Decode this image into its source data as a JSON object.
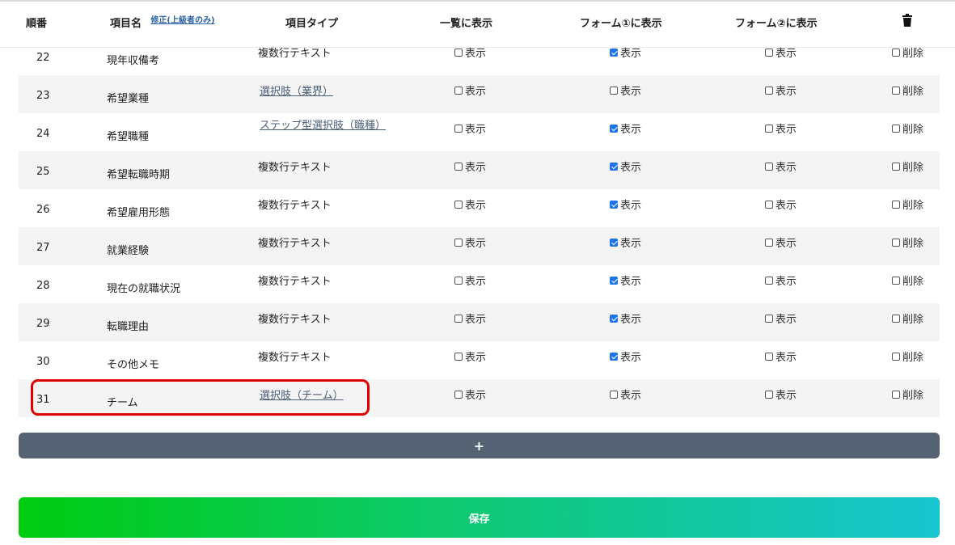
{
  "header": {
    "order": "順番",
    "name": "項目名",
    "name_edit_link": "修正(上級者のみ)",
    "type": "項目タイプ",
    "show_in_list": "一覧に表示",
    "show_in_form1": "フォーム①に表示",
    "show_in_form2": "フォーム②に表示",
    "trash_icon": "trash-icon"
  },
  "labels": {
    "show": "表示",
    "delete": "削除"
  },
  "rows": [
    {
      "order": "22",
      "name": "現年収備考",
      "type": "複数行テキスト",
      "type_is_link": false,
      "list": false,
      "form1": true,
      "form2": false,
      "delete": false
    },
    {
      "order": "23",
      "name": "希望業種",
      "type": "選択肢（業界）",
      "type_is_link": true,
      "list": false,
      "form1": false,
      "form2": false,
      "delete": false
    },
    {
      "order": "24",
      "name": "希望職種",
      "type": "ステップ型選択肢（職種）",
      "type_is_link": true,
      "list": false,
      "form1": true,
      "form2": false,
      "delete": false
    },
    {
      "order": "25",
      "name": "希望転職時期",
      "type": "複数行テキスト",
      "type_is_link": false,
      "list": false,
      "form1": true,
      "form2": false,
      "delete": false
    },
    {
      "order": "26",
      "name": "希望雇用形態",
      "type": "複数行テキスト",
      "type_is_link": false,
      "list": false,
      "form1": true,
      "form2": false,
      "delete": false
    },
    {
      "order": "27",
      "name": "就業経験",
      "type": "複数行テキスト",
      "type_is_link": false,
      "list": false,
      "form1": true,
      "form2": false,
      "delete": false
    },
    {
      "order": "28",
      "name": "現在の就職状況",
      "type": "複数行テキスト",
      "type_is_link": false,
      "list": false,
      "form1": true,
      "form2": false,
      "delete": false
    },
    {
      "order": "29",
      "name": "転職理由",
      "type": "複数行テキスト",
      "type_is_link": false,
      "list": false,
      "form1": true,
      "form2": false,
      "delete": false
    },
    {
      "order": "30",
      "name": "その他メモ",
      "type": "複数行テキスト",
      "type_is_link": false,
      "list": false,
      "form1": true,
      "form2": false,
      "delete": false
    },
    {
      "order": "31",
      "name": "チーム",
      "type": "選択肢（チーム）",
      "type_is_link": true,
      "list": false,
      "form1": false,
      "form2": false,
      "delete": false
    }
  ],
  "buttons": {
    "add": "+",
    "save": "保存"
  },
  "colors": {
    "checkbox_checked": "#1e73e8",
    "link": "#4a5d78",
    "add_button": "#546273",
    "highlight": "#e00000"
  }
}
